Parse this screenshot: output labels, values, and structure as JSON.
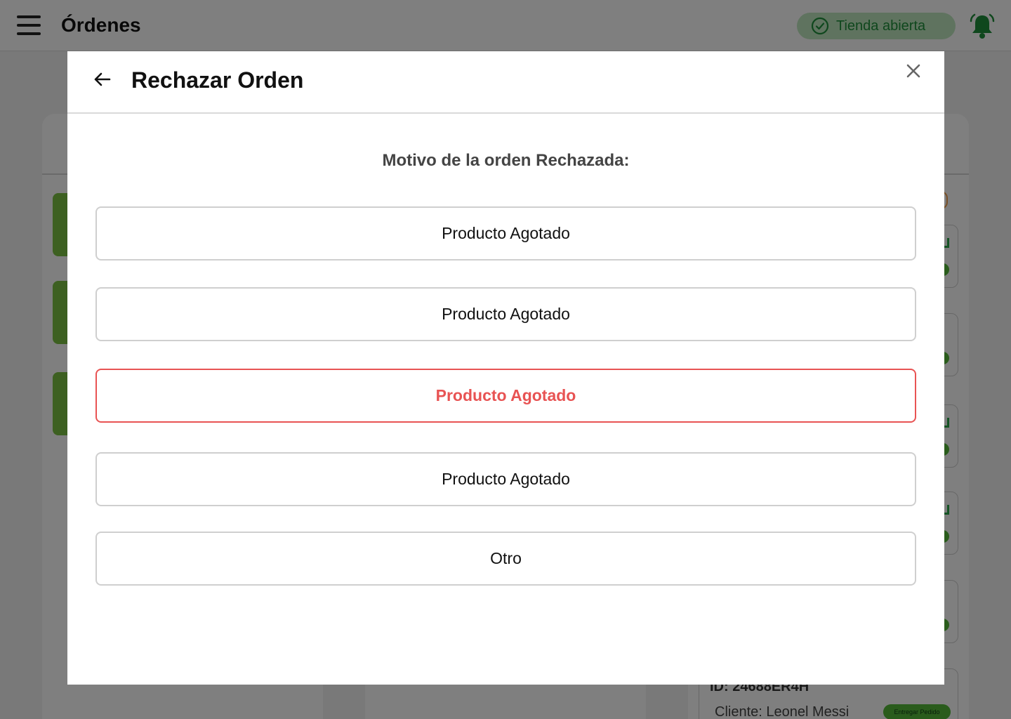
{
  "app": {
    "title": "Órdenes",
    "store_status": "Tienda abierta",
    "accent_color": "#55b838",
    "danger_color": "#e85353"
  },
  "background_order": {
    "id": "ID: 24688ER4H",
    "client": "Cliente: Leonel Messi",
    "action": "Entregar Pedido"
  },
  "modal": {
    "title": "Rechazar Orden",
    "subtitle": "Motivo de la orden Rechazada:",
    "options": [
      {
        "label": "Producto Agotado",
        "selected": false
      },
      {
        "label": "Producto Agotado",
        "selected": false
      },
      {
        "label": "Producto Agotado",
        "selected": true
      },
      {
        "label": "Producto Agotado",
        "selected": false
      },
      {
        "label": "Otro",
        "selected": false
      }
    ]
  },
  "icons": {
    "menu": "menu-icon",
    "store_status": "check-circle-icon",
    "notifications": "bell-ringing-icon",
    "back": "arrow-left-icon",
    "close": "close-icon"
  }
}
